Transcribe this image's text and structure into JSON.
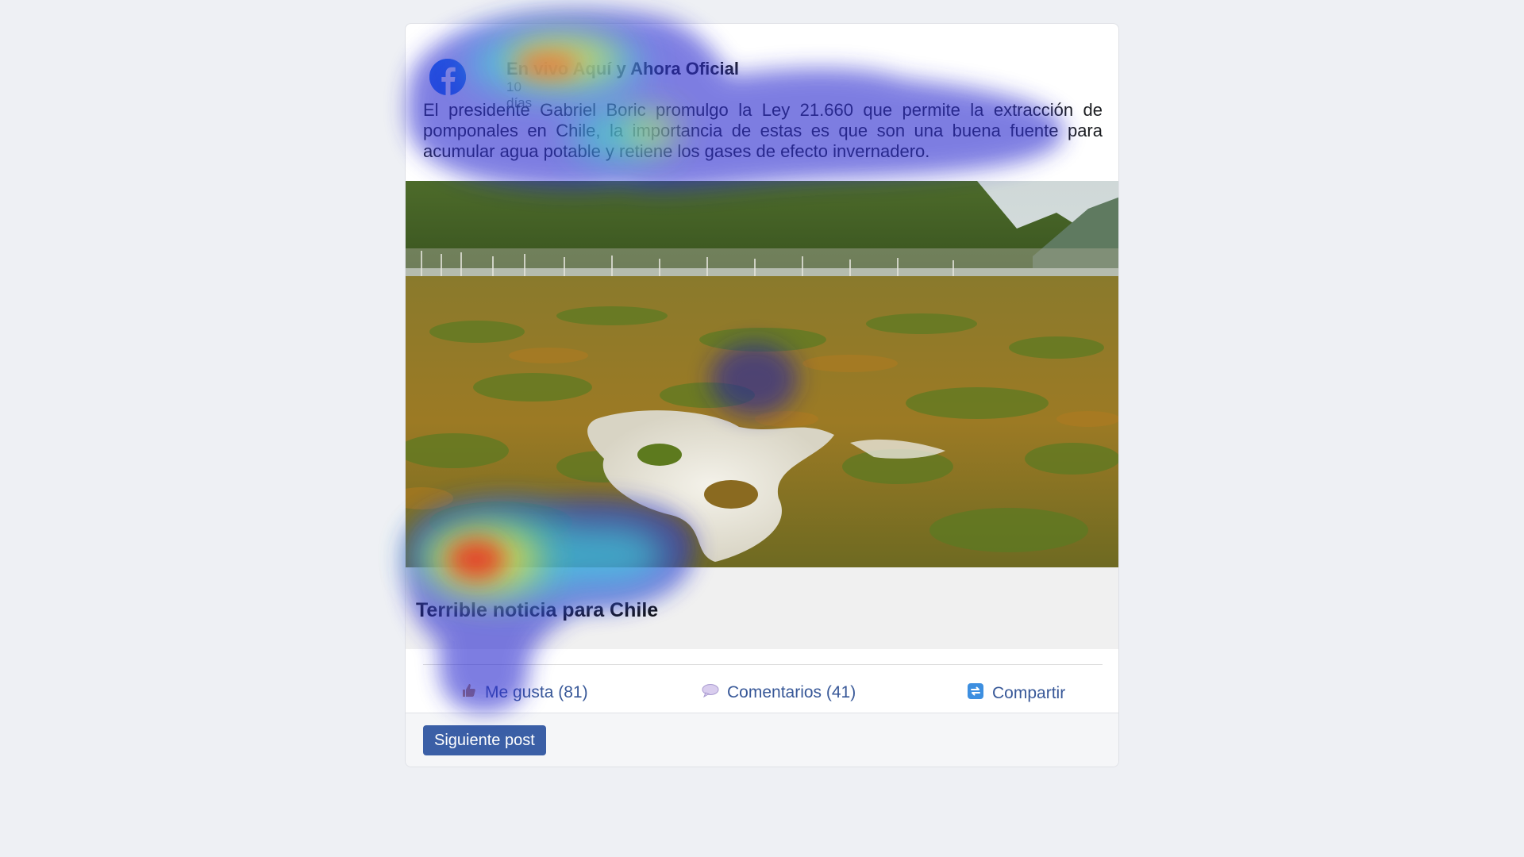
{
  "post": {
    "author": "En vivo Aquí y Ahora Oficial",
    "time": "10 días",
    "text": "El presidente Gabriel Boric promulgo la Ley 21.660 que permite la extracción de pomponales en Chile, la importancia de estas es que son una buena fuente para acumular agua potable y retiene los gases de efecto invernadero.",
    "link_title": "Terrible noticia para Chile"
  },
  "actions": {
    "like": "Me gusta (81)",
    "comments": "Comentarios (41)",
    "share": "Compartir"
  },
  "footer": {
    "next_button": "Siguiente post"
  },
  "icons": {
    "logo": "facebook-logo-icon",
    "like": "thumbs-up-icon",
    "comments": "speech-bubble-icon",
    "share": "share-arrows-icon"
  },
  "colors": {
    "page_bg": "#eef0f4",
    "card_bg": "#ffffff",
    "link_blue": "#385898",
    "button_blue": "#3b5fa6",
    "facebook_blue": "#1877f2"
  }
}
